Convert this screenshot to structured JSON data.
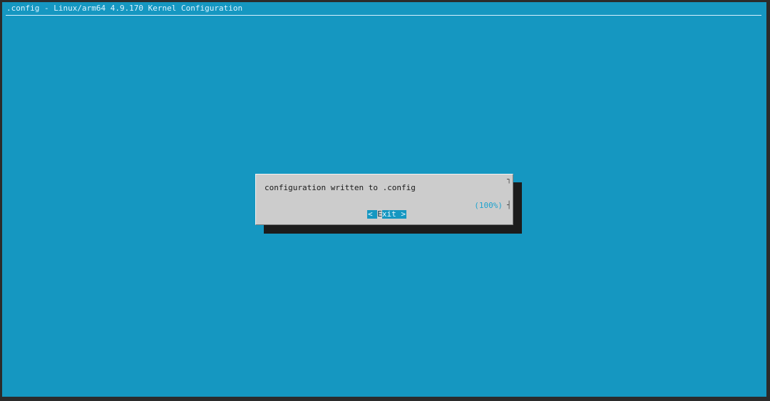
{
  "window": {
    "backtitle": ".config - Linux/arm64 4.9.170 Kernel Configuration"
  },
  "dialog": {
    "message": "configuration written to .config",
    "progress_label": "(100%)",
    "progress_percent": 100,
    "exit_button": {
      "left_bracket": "<",
      "hotkey": "E",
      "rest": "xit",
      "right_bracket": ">"
    }
  },
  "colors": {
    "background": "#1597c1",
    "dialog": "#cccccc",
    "shadow": "#1c1c1c",
    "accent": "#1fa3cf"
  }
}
